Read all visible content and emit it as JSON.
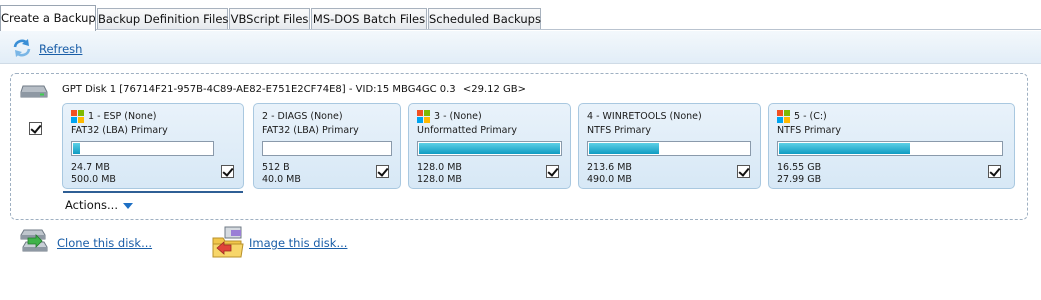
{
  "tabs": [
    {
      "label": "Create a Backup",
      "active": true
    },
    {
      "label": "Backup Definition Files",
      "active": false
    },
    {
      "label": "VBScript Files",
      "active": false
    },
    {
      "label": "MS-DOS Batch Files",
      "active": false
    },
    {
      "label": "Scheduled Backups",
      "active": false
    }
  ],
  "toolbar": {
    "refresh_label": "Refresh"
  },
  "disk": {
    "title": "GPT Disk 1 [76714F21-957B-4C89-AE82-E751E2CF74E8] - VID:15 MBG4GC 0.3",
    "size": "<29.12 GB>",
    "checked": true
  },
  "partitions": [
    {
      "label": "1 - ESP (None)",
      "type": "FAT32 (LBA) Primary",
      "used": "24.7 MB",
      "total": "500.0 MB",
      "used_fraction": 0.05,
      "checked": true
    },
    {
      "label": "2 - DIAGS (None)",
      "type": "FAT32 (LBA) Primary",
      "used": "512 B",
      "total": "40.0 MB",
      "used_fraction": 0.0,
      "checked": true
    },
    {
      "label": "3 -  (None)",
      "type": "Unformatted Primary",
      "used": "128.0 MB",
      "total": "128.0 MB",
      "used_fraction": 1.0,
      "checked": true
    },
    {
      "label": "4 - WINRETOOLS (None)",
      "type": "NTFS Primary",
      "used": "213.6 MB",
      "total": "490.0 MB",
      "used_fraction": 0.44,
      "checked": true
    },
    {
      "label": "5 -  (C:)",
      "type": "NTFS Primary",
      "used": "16.55 GB",
      "total": "27.99 GB",
      "used_fraction": 0.59,
      "checked": true
    }
  ],
  "actions_label": "Actions...",
  "bottom": {
    "clone_label": "Clone this disk...",
    "image_label": "Image this disk..."
  },
  "colors": {
    "accent": "#1a5ea8",
    "bar_fill": "#0f9cc2",
    "card_bg": "#dfeef9",
    "win_red": "#f25022",
    "win_green": "#7fba00",
    "win_blue": "#00a4ef",
    "win_yellow": "#ffb900"
  },
  "icons": {
    "refresh": "refresh-icon",
    "disk": "hard-disk-icon",
    "clone": "clone-disk-icon",
    "image": "image-disk-icon",
    "partition_flag": "windows-flag-icon",
    "dropdown": "chevron-down-icon"
  }
}
